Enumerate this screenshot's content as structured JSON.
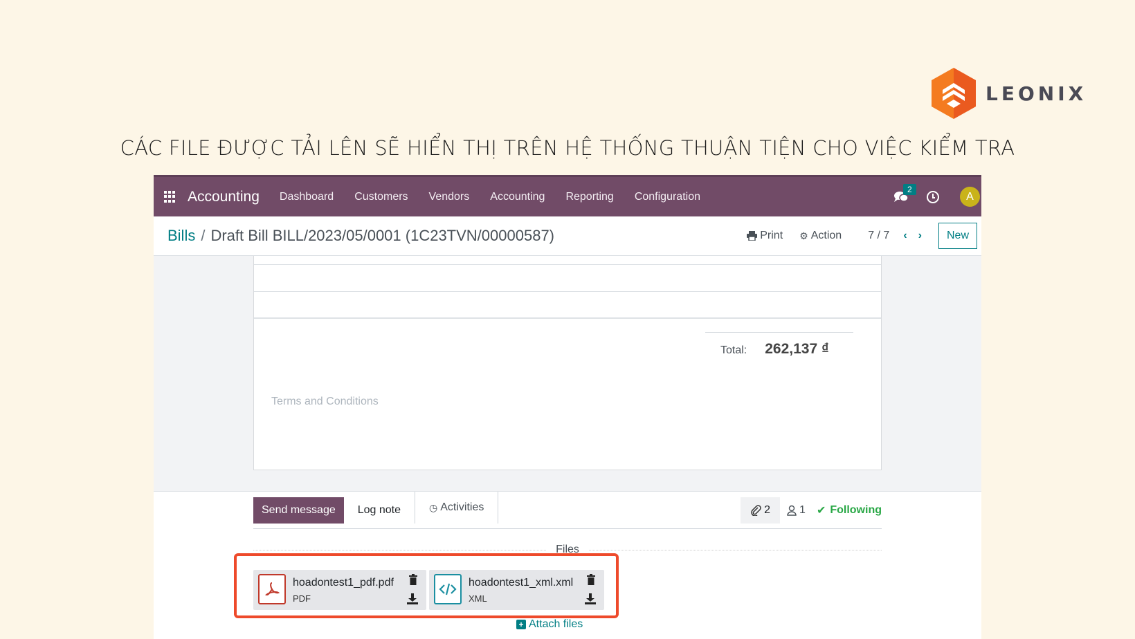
{
  "brand": {
    "logo_text": "LEONIX"
  },
  "headline": "CÁC FILE ĐƯỢC TẢI LÊN SẼ HIỂN THỊ TRÊN HỆ THỐNG THUẬN TIỆN CHO VIỆC KIỂM TRA",
  "navbar": {
    "app_name": "Accounting",
    "menu": [
      "Dashboard",
      "Customers",
      "Vendors",
      "Accounting",
      "Reporting",
      "Configuration"
    ],
    "messages_badge": "2",
    "avatar_letter": "A"
  },
  "control_panel": {
    "breadcrumb_parent": "Bills",
    "breadcrumb_sep": "/",
    "breadcrumb_current": "Draft Bill BILL/2023/05/0001 (1C23TVN/00000587)",
    "print_label": "Print",
    "action_label": "Action",
    "pager": "7 / 7",
    "new_label": "New"
  },
  "sheet": {
    "total_label": "Total:",
    "total_value": "262,137 ₫",
    "terms_placeholder": "Terms and Conditions"
  },
  "chatter": {
    "send_message": "Send message",
    "log_note": "Log note",
    "activities": "Activities",
    "attachment_count": "2",
    "follower_count": "1",
    "following": "Following",
    "files_label": "Files",
    "attach_files": "Attach files",
    "files": [
      {
        "name": "hoadontest1_pdf.pdf",
        "type": "PDF",
        "icon": "pdf-icon"
      },
      {
        "name": "hoadontest1_xml.xml",
        "type": "XML",
        "icon": "code-icon"
      }
    ]
  },
  "colors": {
    "navbar": "#714b67",
    "accent": "#017e84",
    "highlight": "#ee4a2b",
    "background": "#fdf6e7"
  }
}
